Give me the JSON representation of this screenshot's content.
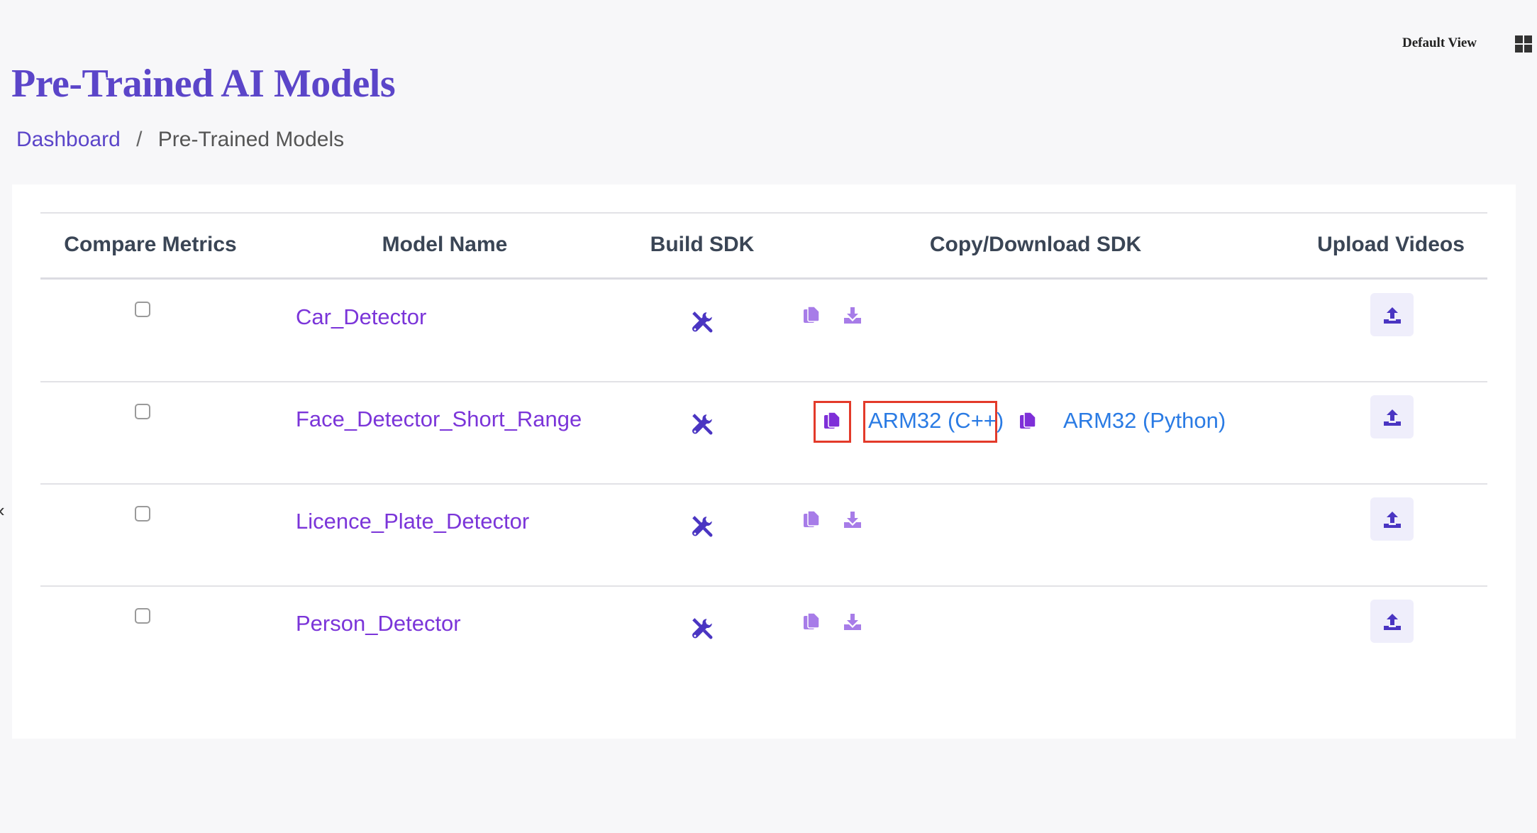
{
  "header": {
    "view_label": "Default View",
    "view_icon": "grid-icon",
    "title": "Pre-Trained AI Models"
  },
  "breadcrumb": {
    "items": [
      "Dashboard",
      "Pre-Trained Models"
    ],
    "separator": "/"
  },
  "table": {
    "columns": [
      "Compare Metrics",
      "Model Name",
      "Build SDK",
      "Copy/Download SDK",
      "Upload Videos"
    ],
    "rows": [
      {
        "model_name": "Car_Detector",
        "sdk_links": []
      },
      {
        "model_name": "Face_Detector_Short_Range",
        "sdk_links": [
          "ARM32 (C++)",
          "ARM32 (Python)"
        ]
      },
      {
        "model_name": "Licence_Plate_Detector",
        "sdk_links": []
      },
      {
        "model_name": "Person_Detector",
        "sdk_links": []
      }
    ]
  },
  "colors": {
    "accent": "#5b45c9",
    "model_link": "#7b35d9",
    "sdk_link": "#2a7be4",
    "icon_light": "#a77ce8",
    "icon_dark": "#7e2fd8",
    "highlight": "#e33a2a"
  },
  "icons": {
    "build": "tools-icon",
    "copy": "copy-icon",
    "download": "download-icon",
    "upload": "upload-icon"
  }
}
